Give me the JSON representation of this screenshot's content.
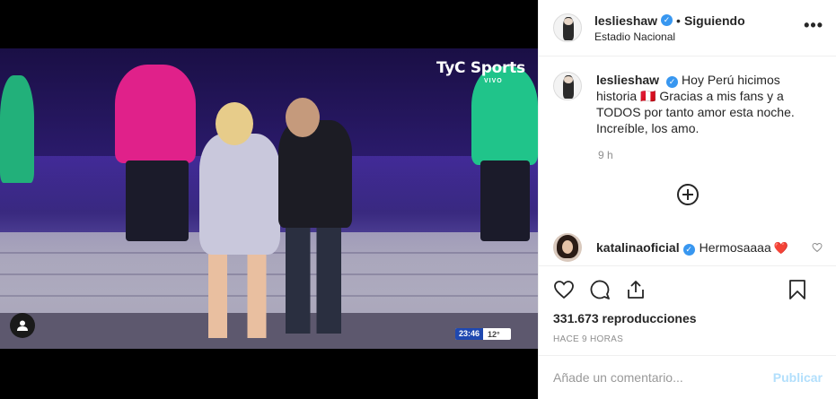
{
  "video": {
    "logo_text": "TyC Sports",
    "logo_sub": "VIVO",
    "clock_time": "23:46",
    "clock_extra": "12°"
  },
  "header": {
    "username": "leslieshaw",
    "separator": "•",
    "follow_status": "Siguiendo",
    "location": "Estadio Nacional",
    "more_label": "•••"
  },
  "caption": {
    "username": "leslieshaw",
    "text": "Hoy Perú hicimos historia 🇵🇪 Gracias a mis fans y a TODOS por tanto amor esta noche. Increíble, los amo.",
    "time": "9 h"
  },
  "comment": {
    "username": "katalinaoficial",
    "text": "Hermosaaaa",
    "emoji": "❤️"
  },
  "actions": {
    "views": "331.673 reproducciones",
    "ago": "HACE 9 HORAS"
  },
  "add_comment": {
    "placeholder": "Añade un comentario...",
    "post_label": "Publicar"
  },
  "colors": {
    "verified": "#3897f0",
    "post_disabled": "#b2dffc"
  }
}
